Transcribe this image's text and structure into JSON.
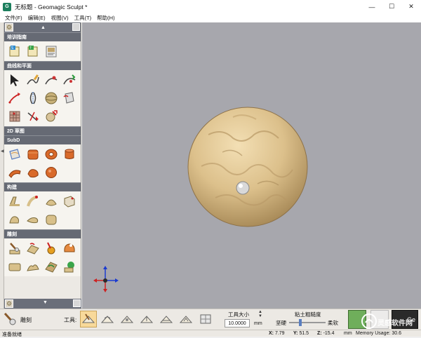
{
  "window": {
    "title": "无标题 - Geomagic Sculpt *",
    "controls": [
      "minimize",
      "maximize",
      "close"
    ]
  },
  "menu": {
    "items": [
      "文件(F)",
      "编辑(E)",
      "视图(V)",
      "工具(T)",
      "帮助(H)"
    ]
  },
  "palette": {
    "sections": [
      {
        "title": "培训指南",
        "tools": [
          "tutorial-book-1-icon",
          "tutorial-book-2-icon",
          "tutorial-book-3-icon"
        ]
      },
      {
        "title": "曲线和平面",
        "tools": [
          "select-arrow-icon",
          "draw-curve-icon",
          "curve-edit-icon",
          "curve-move-icon",
          "curve-red-icon",
          "mirror-curve-icon",
          "plane-sphere-icon",
          "plane-box-icon",
          "clay-grid-icon",
          "curve-split-icon",
          "curve-cut-icon"
        ]
      },
      {
        "title": "2D 草图",
        "tools": []
      },
      {
        "title": "SubD",
        "tools": [
          "subd-plane-icon",
          "subd-cube-icon",
          "subd-torus-icon",
          "subd-cylinder-icon",
          "subd-pipe-icon",
          "subd-blob-icon",
          "subd-sphere-icon"
        ]
      },
      {
        "title": "构建",
        "tools": [
          "build-extrude-icon",
          "build-pipe-icon",
          "build-loft-icon",
          "build-box-icon",
          "build-shape-icon",
          "build-drop-icon",
          "build-pad-icon"
        ]
      },
      {
        "title": "雕刻",
        "tools": [
          "sculpt-tool-icon",
          "sculpt-smooth-icon",
          "sculpt-paint-icon",
          "sculpt-blob-icon",
          "sculpt-flat-icon",
          "sculpt-ridge-icon",
          "sculpt-emboss-icon",
          "sculpt-green-icon"
        ]
      }
    ]
  },
  "toolbar": {
    "mode_label": "雕刻",
    "tools_label": "工具:",
    "tool_size_label": "工具大小",
    "tool_size_value": "10.0000",
    "tool_size_unit": "mm",
    "viscosity_label": "粘土粗糙度",
    "viscosity_left": "坚硬",
    "viscosity_right": "柔软",
    "viscosity_level": 0.3,
    "right_button_text": "Ge"
  },
  "status": {
    "ready": "准备就绪",
    "x_label": "X:",
    "x_value": "7.79",
    "y_label": "Y:",
    "y_value": "51.5",
    "z_label": "Z:",
    "z_value": "-15.4",
    "unit": "mm",
    "memory": "Memory Usage: 30.6"
  },
  "watermark": {
    "text": "灵感软件网"
  },
  "colors": {
    "sphere": "#d9bf8a",
    "viewport_bg": "#a7a7ad",
    "palette_header": "#666a74"
  }
}
